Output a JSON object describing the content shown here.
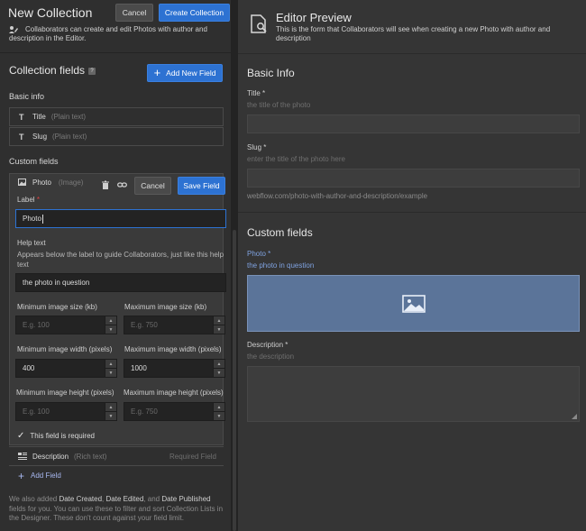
{
  "header": {
    "title": "New Collection",
    "cancel_label": "Cancel",
    "create_label": "Create Collection"
  },
  "intro": {
    "line1": "Collaborators can create and edit Photos with author and",
    "line2": "description in the Editor."
  },
  "collection_fields": {
    "title": "Collection fields",
    "help_badge": "?",
    "add_new_label": "Add New Field"
  },
  "basic_info": {
    "title": "Basic info",
    "fields": [
      {
        "icon": "T",
        "name": "Title",
        "type": "(Plain text)"
      },
      {
        "icon": "T",
        "name": "Slug",
        "type": "(Plain text)"
      }
    ]
  },
  "custom_fields": {
    "title": "Custom fields",
    "photo": {
      "name": "Photo",
      "type": "(Image)",
      "cancel_label": "Cancel",
      "save_label": "Save Field",
      "label_label": "Label",
      "label_required": "*",
      "label_value": "Photo",
      "helptext_label": "Help text",
      "helptext_desc": "Appears below the label to guide Collaborators, just like this help text",
      "helptext_value": "the photo in question",
      "min_size_label": "Minimum image size (kb)",
      "max_size_label": "Maximum image size (kb)",
      "min_size_placeholder": "E.g. 100",
      "max_size_placeholder": "E.g. 750",
      "min_width_label": "Minimum image width (pixels)",
      "max_width_label": "Maximum image width (pixels)",
      "min_width_value": "400",
      "max_width_value": "1000",
      "min_height_label": "Minimum image height (pixels)",
      "max_height_label": "Maximum image height (pixels)",
      "min_height_placeholder": "E.g. 100",
      "max_height_placeholder": "E.g. 750",
      "required_label": "This field is required",
      "required_checked": true
    },
    "description": {
      "name": "Description",
      "type": "(Rich text)",
      "badge": "Required Field"
    },
    "add_field_label": "Add Field"
  },
  "footer": {
    "p1": "We also added ",
    "b1": "Date Created",
    "p2": ", ",
    "b2": "Date Edited",
    "p3": ", and ",
    "b3": "Date Published",
    "p4": " fields for you. You can use these to filter and sort Collection Lists in the Designer. These don't count against your field limit."
  },
  "preview": {
    "title": "Editor Preview",
    "subtitle": "This is the form that Collaborators will see when creating a new Photo with author and description",
    "basic_info_title": "Basic Info",
    "title_label": "Title *",
    "title_hint": "the title of the photo",
    "slug_label": "Slug *",
    "slug_hint": "enter the title of the photo here",
    "slug_url": "webflow.com/photo-with-author-and-description/example",
    "custom_fields_title": "Custom fields",
    "photo_label": "Photo *",
    "photo_hint": "the photo in question",
    "description_label": "Description *",
    "description_hint": "the description"
  },
  "colors": {
    "accent": "#2d72d2",
    "photo_box": "#5b7499",
    "required": "#e04040",
    "add_field_link": "#a8b8f0"
  }
}
